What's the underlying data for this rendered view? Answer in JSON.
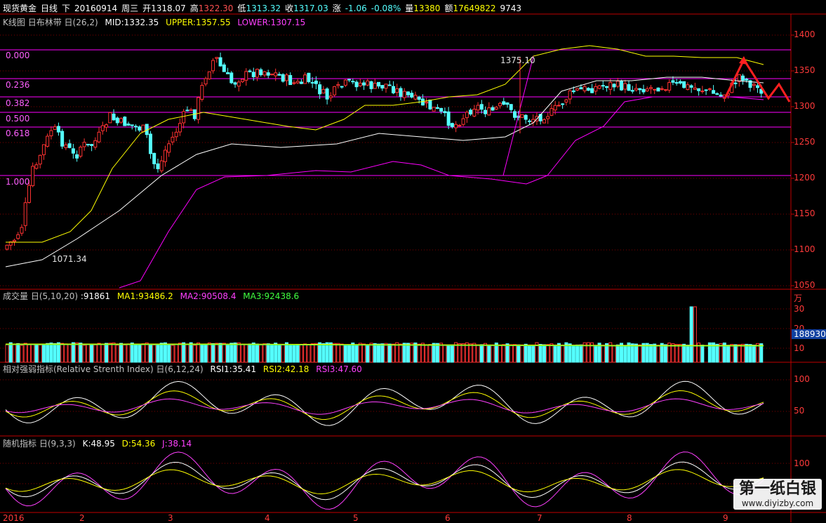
{
  "header": {
    "name": "现货黄金",
    "period": "日线",
    "mode": "下",
    "date": "20160914",
    "weekday": "周三",
    "open_label": "开",
    "open": "1318.07",
    "high_label": "高",
    "high": "1322.30",
    "low_label": "低",
    "low": "1313.32",
    "close_label": "收",
    "close": "1317.03",
    "chg_label": "涨",
    "chg": "-1.06",
    "pct": "-0.08%",
    "vol_label": "量",
    "vol": "13380",
    "amt_label": "额",
    "amt": "17649822",
    "extra": "9743"
  },
  "kline": {
    "title": "K线图",
    "indicator": "日布林带",
    "params": "日(26,2)",
    "mid": "MID:1332.35",
    "upper": "UPPER:1357.55",
    "lower": "LOWER:1307.15",
    "high_annot": "1375.10",
    "low_annot": "1071.34",
    "fib": [
      "0.000",
      "0.236",
      "0.382",
      "0.500",
      "0.618",
      "1.000"
    ],
    "axis": [
      "1400",
      "1350",
      "1300",
      "1250",
      "1200",
      "1150",
      "1100",
      "1050"
    ]
  },
  "volume": {
    "title": "成交量",
    "params": "日(5,10,20)",
    "value": ":91861",
    "ma1": "MA1:93486.2",
    "ma2": "MA2:90508.4",
    "ma3": "MA3:92438.6",
    "unit": "万",
    "axis": [
      "30",
      "20",
      "10"
    ],
    "badge": "188930"
  },
  "rsi": {
    "title": "相对强弱指标(Relative Strenth Index)",
    "params": "日(6,12,24)",
    "rsi1": "RSI1:35.41",
    "rsi2": "RSI2:42.18",
    "rsi3": "RSI3:47.60",
    "axis": [
      "100",
      "50"
    ]
  },
  "kdj": {
    "title": "随机指标",
    "params": "日(9,3,3)",
    "k": "K:48.95",
    "d": "D:54.36",
    "j": "J:38.14",
    "axis": [
      "100",
      "50"
    ]
  },
  "months": [
    "2016",
    "2",
    "3",
    "4",
    "5",
    "6",
    "7",
    "8",
    "9"
  ],
  "watermark": {
    "title": "第一纸白银",
    "url": "www.diyizby.com"
  },
  "colors": {
    "up": "#ff3232",
    "down": "#54ffff",
    "mid": "#ffffff",
    "upper": "#ffff00",
    "lower": "#ff00ff",
    "fib": "#ff00ff",
    "grid": "#800000"
  }
}
